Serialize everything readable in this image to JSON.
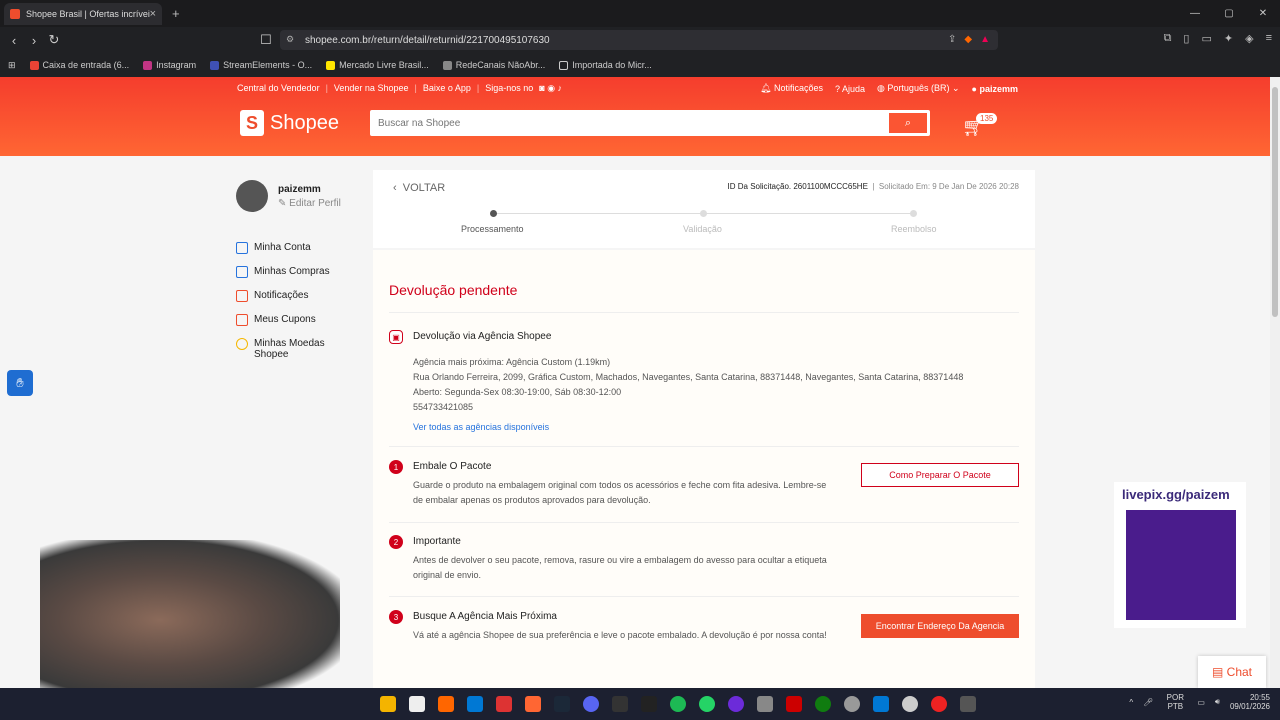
{
  "browser": {
    "tab_title": "Shopee Brasil | Ofertas incríveis.",
    "url": "shopee.com.br/return/detail/returnid/221700495107630",
    "bookmarks": [
      "Caixa de entrada (6...",
      "Instagram",
      "StreamElements - O...",
      "Mercado Livre Brasil...",
      "RedeCanais NãoAbr...",
      "Importada do Micr..."
    ]
  },
  "header": {
    "links": [
      "Central do Vendedor",
      "Vender na Shopee",
      "Baixe o App",
      "Siga-nos no"
    ],
    "notifications": "Notificações",
    "help": "Ajuda",
    "language": "Português (BR)",
    "user": "paizemm",
    "logo": "Shopee",
    "search_placeholder": "Buscar na Shopee",
    "cart_count": "135"
  },
  "sidebar": {
    "username": "paizemm",
    "edit": "Editar Perfil",
    "items": [
      "Minha Conta",
      "Minhas Compras",
      "Notificações",
      "Meus Cupons",
      "Minhas Moedas Shopee"
    ]
  },
  "status": {
    "back": "VOLTAR",
    "request_id": "ID Da Solicitação. 2601100MCCC65HE",
    "requested": "Solicitado Em: 9 De Jan De 2026 20:28",
    "steps": [
      "Processamento",
      "Validação",
      "Reembolso"
    ]
  },
  "detail": {
    "heading": "Devolução pendente",
    "agency_title": "Devolução via Agência Shopee",
    "agency_lines": [
      "Agência mais próxima: Agência Custom (1.19km)",
      "Rua Orlando Ferreira, 2099, Gráfica Custom, Machados, Navegantes, Santa Catarina, 88371448, Navegantes, Santa Catarina, 88371448",
      "Aberto: Segunda-Sex 08:30-19:00, Sáb 08:30-12:00",
      "554733421085"
    ],
    "agency_link": "Ver todas as agências disponíveis",
    "step1_title": "Embale O Pacote",
    "step1_text": "Guarde o produto na embalagem original com todos os acessórios e feche com fita adesiva. Lembre-se de embalar apenas os produtos aprovados para devolução.",
    "step1_btn": "Como Preparar O Pacote",
    "step2_title": "Importante",
    "step2_text": "Antes de devolver o seu pacote, remova, rasure ou vire a embalagem do avesso para ocultar a etiqueta original de envio.",
    "step3_title": "Busque A Agência Mais Próxima",
    "step3_text": "Vá até a agência Shopee de sua preferência e leve o pacote embalado. A devolução é por nossa conta!",
    "step3_btn": "Encontrar Endereço Da Agencia"
  },
  "overlay": {
    "qr_text": "livepix.gg/paizem",
    "chat": "Chat"
  },
  "tray": {
    "lang": "POR PTB",
    "time": "20:55",
    "date": "09/01/2026"
  }
}
